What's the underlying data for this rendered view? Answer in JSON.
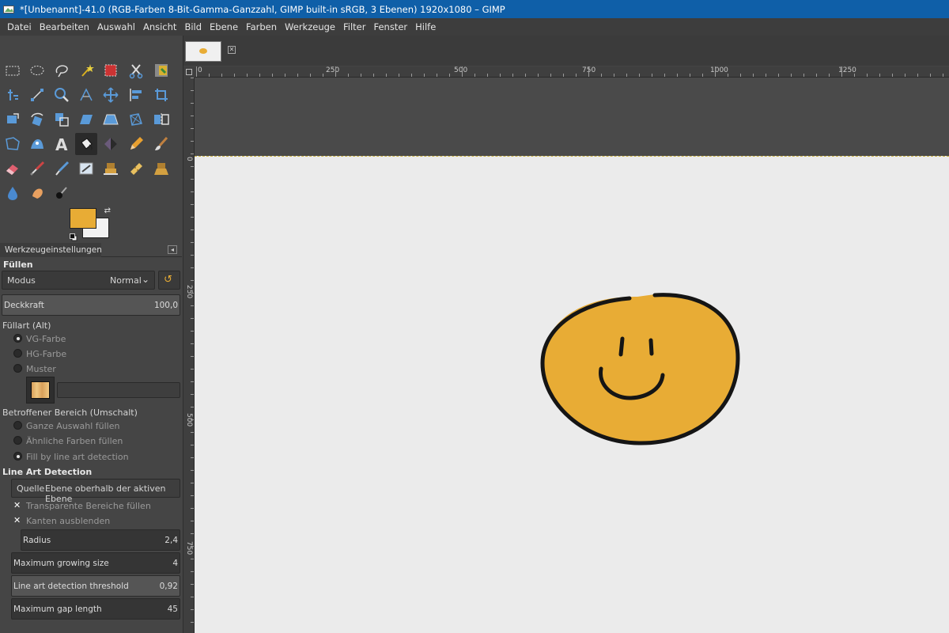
{
  "window": {
    "title": "*[Unbenannt]-41.0 (RGB-Farben 8-Bit-Gamma-Ganzzahl, GIMP built-in sRGB, 3 Ebenen) 1920x1080 – GIMP"
  },
  "menubar": [
    "Datei",
    "Bearbeiten",
    "Auswahl",
    "Ansicht",
    "Bild",
    "Ebene",
    "Farben",
    "Werkzeuge",
    "Filter",
    "Fenster",
    "Hilfe"
  ],
  "colors": {
    "foreground": "#e8ac35",
    "background": "#f2f2f2",
    "canvas_bg": "#ebebeb",
    "titlebar": "#0f5fa8"
  },
  "toolbox": {
    "tools": [
      "rect-select-icon",
      "ellipse-select-icon",
      "lasso-icon",
      "fuzzy-select-icon",
      "select-by-color-icon",
      "scissors-icon",
      "foreground-select-icon",
      "align-icon",
      "path-icon",
      "zoom-icon",
      "measure-icon",
      "move-icon",
      "align-tool-icon",
      "crop-icon",
      "unified-transform-icon",
      "rotate-icon",
      "scale-icon",
      "shear-icon",
      "perspective-icon",
      "3d-transform-icon",
      "flip-icon",
      "cage-transform-icon",
      "warp-transform-icon",
      "text-icon",
      "bucket-fill-icon",
      "gradient-icon",
      "pencil-icon",
      "paintbrush-icon",
      "eraser-icon",
      "airbrush-icon",
      "ink-icon",
      "mypaint-brush-icon",
      "clone-icon",
      "heal-icon",
      "perspective-clone-icon",
      "blur-icon",
      "smudge-icon",
      "dodge-burn-icon"
    ]
  },
  "tool_options": {
    "tab_label": "Werkzeugeinstellungen",
    "section_title": "Füllen",
    "mode_label": "Modus",
    "mode_value": "Normal",
    "opacity_label": "Deckkraft",
    "opacity_value": "100,0",
    "fill_type_label": "Füllart  (Alt)",
    "fill_types": [
      "VG-Farbe",
      "HG-Farbe",
      "Muster"
    ],
    "fill_type_selected": 0,
    "affected_area_label": "Betroffener Bereich  (Umschalt)",
    "affected_areas": [
      "Ganze Auswahl füllen",
      "Ähnliche Farben füllen",
      "Fill by line art detection"
    ],
    "affected_area_selected": 2,
    "line_art_title": "Line Art Detection",
    "source_label": "Quelle",
    "source_value": "Ebene oberhalb der aktiven Ebene",
    "checkboxes": [
      "Transparente Bereiche füllen",
      "Kanten ausblenden"
    ],
    "sliders": [
      {
        "label": "Radius",
        "value": "2,4"
      },
      {
        "label": "Maximum growing size",
        "value": "4"
      },
      {
        "label": "Line art detection threshold",
        "value": "0,92"
      },
      {
        "label": "Maximum gap length",
        "value": "45"
      }
    ]
  },
  "ruler": {
    "h_labels": [
      "0",
      "250",
      "500",
      "750",
      "1000",
      "1250"
    ],
    "v_labels": [
      "0",
      "250",
      "500",
      "750"
    ]
  }
}
